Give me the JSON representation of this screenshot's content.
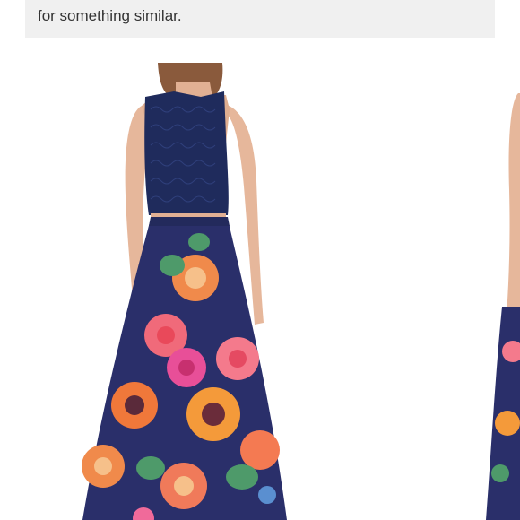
{
  "notice": {
    "text": "for something similar."
  },
  "gallery": {
    "photos": [
      {
        "alt": "navy crop top floral ball gown back view"
      },
      {
        "alt": "navy crop top floral ball gown side view"
      }
    ],
    "colors": {
      "background": "#ffffff",
      "notice_bg": "#f0f0f0",
      "navy": "#2a2f6a",
      "lace": "#1f2b5c",
      "skin": "#e6b79b",
      "hair": "#8a5a3c"
    }
  }
}
